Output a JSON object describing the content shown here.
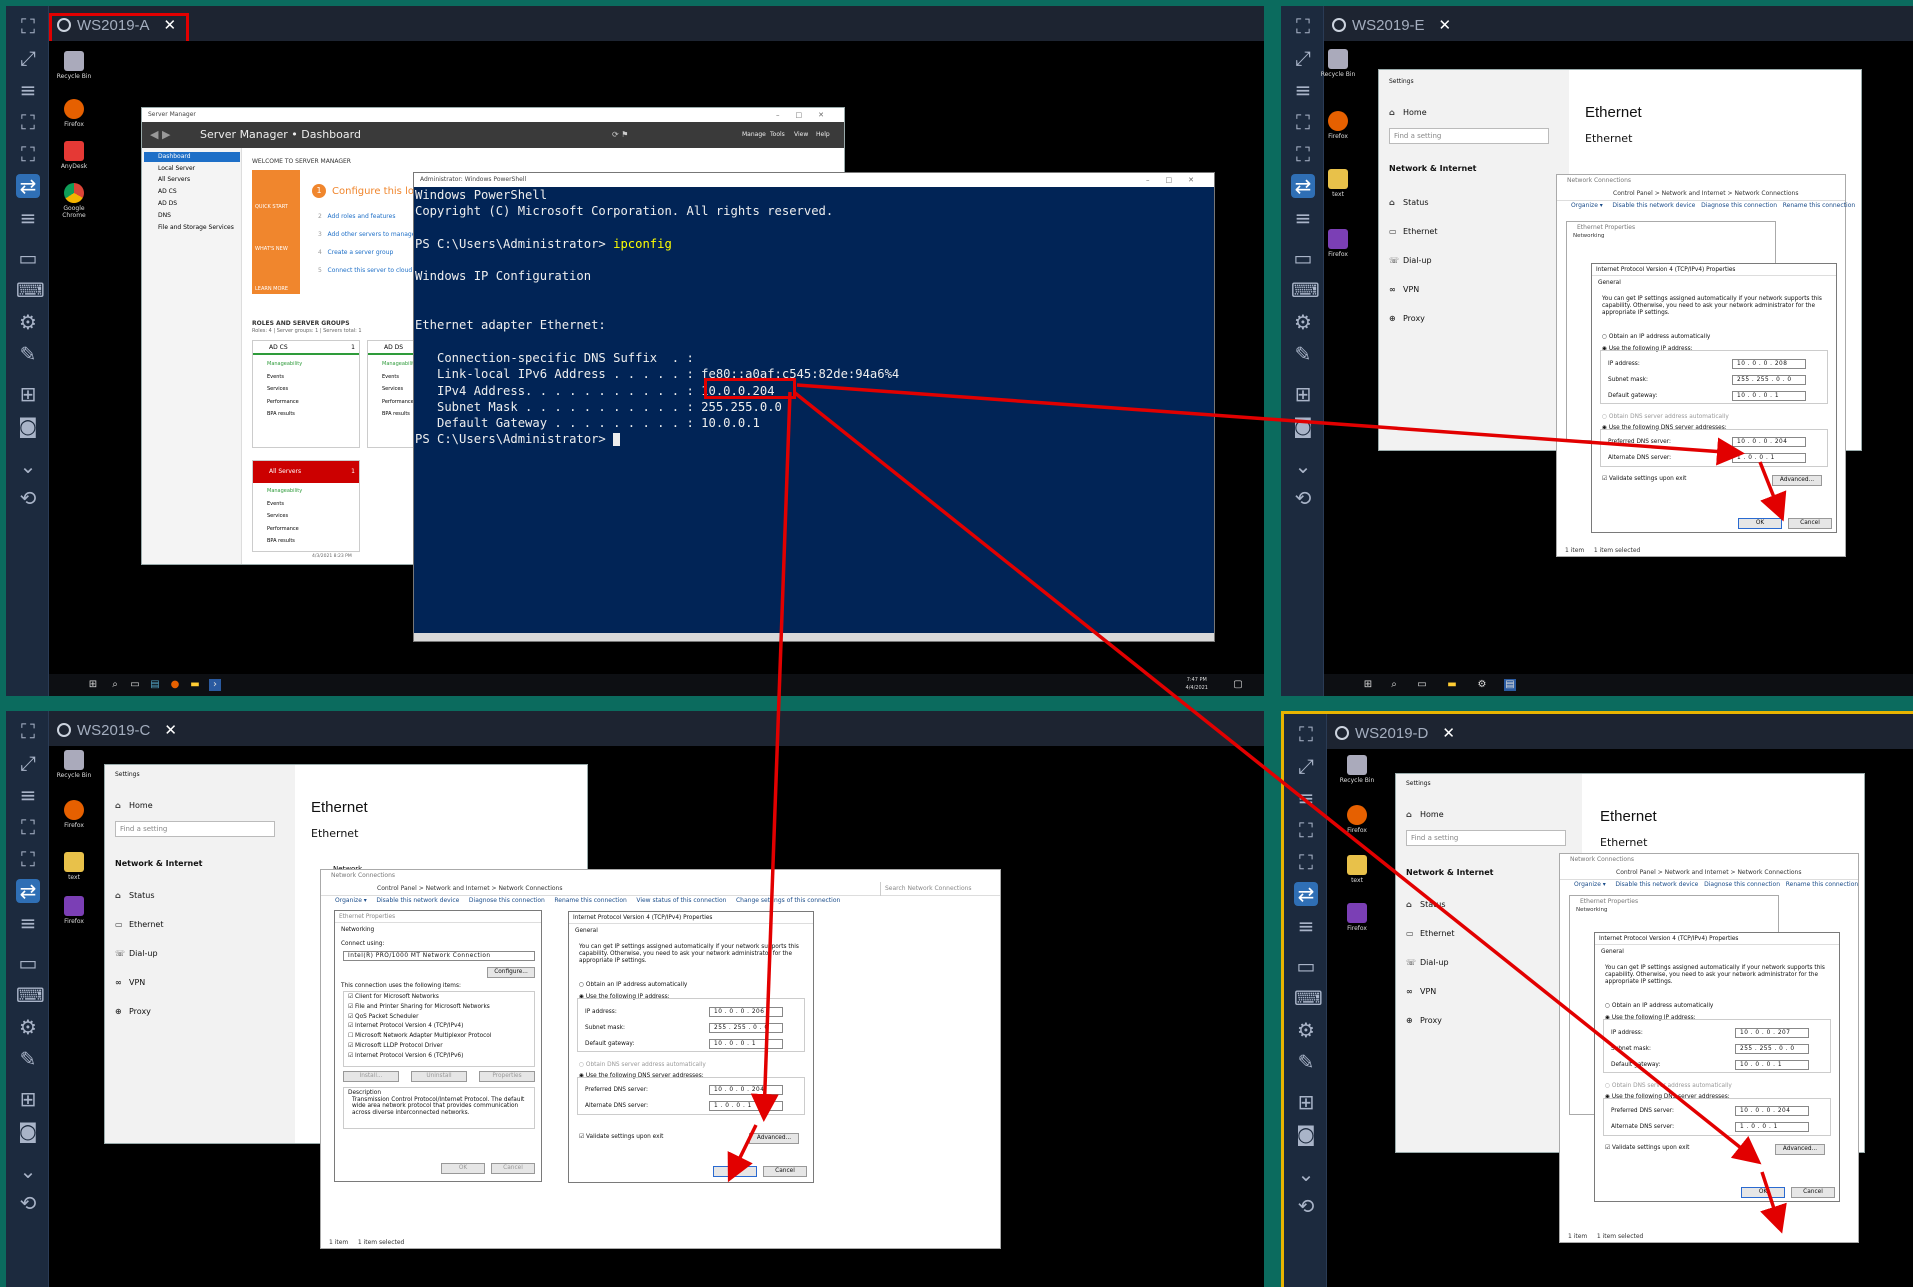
{
  "sessions": {
    "a": {
      "title": "WS2019-A"
    },
    "e": {
      "title": "WS2019-E"
    },
    "c": {
      "title": "WS2019-C"
    },
    "d": {
      "title": "WS2019-D"
    }
  },
  "desktop_icons": {
    "recycle": "Recycle Bin",
    "firefox": "Firefox",
    "anydesk": "AnyDesk",
    "chrome": "Google Chrome",
    "text": "text"
  },
  "server_manager": {
    "title": "Server Manager",
    "breadcrumb": "Server Manager • Dashboard",
    "menu": [
      "Manage",
      "Tools",
      "View",
      "Help"
    ],
    "nav": [
      "Dashboard",
      "Local Server",
      "All Servers",
      "AD CS",
      "AD DS",
      "DNS",
      "File and Storage Services"
    ],
    "welcome": "WELCOME TO SERVER MANAGER",
    "configure": "Configure this local server",
    "steps": [
      "Add roles and features",
      "Add other servers to manage",
      "Create a server group",
      "Connect this server to cloud services"
    ],
    "tiles": [
      "QUICK START",
      "WHAT'S NEW",
      "LEARN MORE"
    ],
    "roles_header": "ROLES AND SERVER GROUPS",
    "roles_sub": "Roles: 4  |  Server groups: 1  |  Servers total: 1",
    "cards": [
      {
        "name": "AD CS",
        "count": "1",
        "rows": [
          "Manageability",
          "Events",
          "Services",
          "Performance",
          "BPA results"
        ]
      },
      {
        "name": "AD DS",
        "count": "1",
        "rows": [
          "Manageability",
          "Events",
          "Services",
          "Performance",
          "BPA results"
        ]
      },
      {
        "name": "All Servers",
        "count": "1",
        "rows": [
          "Manageability",
          "Events",
          "Services",
          "Performance",
          "BPA results"
        ]
      }
    ],
    "timestamp": "4/3/2021 8:23 PM"
  },
  "powershell": {
    "title": "Administrator: Windows PowerShell",
    "lines": [
      "Windows PowerShell",
      "Copyright (C) Microsoft Corporation. All rights reserved.",
      "",
      "PS C:\\Users\\Administrator> ",
      "",
      "Windows IP Configuration",
      "",
      "",
      "Ethernet adapter Ethernet:",
      "",
      "   Connection-specific DNS Suffix  . :",
      "   Link-local IPv6 Address . . . . . : fe80::a0af:c545:82de:94a6%4",
      "   IPv4 Address. . . . . . . . . . . : 10.0.0.204",
      "   Subnet Mask . . . . . . . . . . . : 255.255.0.0",
      "   Default Gateway . . . . . . . . . : 10.0.0.1",
      "PS C:\\Users\\Administrator> "
    ],
    "command": "ipconfig"
  },
  "taskbar_a": {
    "time": "7:47 PM",
    "date": "4/4/2021"
  },
  "settings": {
    "title": "Settings",
    "home": "Home",
    "search_placeholder": "Find a setting",
    "section": "Network & Internet",
    "items": [
      "Status",
      "Ethernet",
      "Dial-up",
      "VPN",
      "Proxy"
    ],
    "heading": "Ethernet",
    "subheading": "Ethernet",
    "network": "Network"
  },
  "network_connections": {
    "title": "Network Connections",
    "path": "Control Panel  >  Network and Internet  >  Network Connections",
    "search": "Search Network Connections",
    "toolbar": [
      "Organize ▾",
      "Disable this network device",
      "Diagnose this connection",
      "Rename this connection",
      "View status of this connection",
      "Change settings of this connection"
    ],
    "status_items": "1 item",
    "status_selected": "1 item selected"
  },
  "ethernet_props": {
    "title": "Ethernet Properties",
    "tab": "Networking",
    "connect_using": "Connect using:",
    "adapter": "Intel(R) PRO/1000 MT Network Connection",
    "configure": "Configure...",
    "items_label": "This connection uses the following items:",
    "items": [
      "Client for Microsoft Networks",
      "File and Printer Sharing for Microsoft Networks",
      "QoS Packet Scheduler",
      "Internet Protocol Version 4 (TCP/IPv4)",
      "Microsoft Network Adapter Multiplexor Protocol",
      "Microsoft LLDP Protocol Driver",
      "Internet Protocol Version 6 (TCP/IPv6)"
    ],
    "install": "Install...",
    "uninstall": "Uninstall",
    "properties": "Properties",
    "description_label": "Description",
    "description": "Transmission Control Protocol/Internet Protocol. The default wide area network protocol that provides communication across diverse interconnected networks.",
    "ok": "OK",
    "cancel": "Cancel"
  },
  "ipv4": {
    "title": "Internet Protocol Version 4 (TCP/IPv4) Properties",
    "tab": "General",
    "intro": "You can get IP settings assigned automatically if your network supports this capability. Otherwise, you need to ask your network administrator for the appropriate IP settings.",
    "obtain_ip": "Obtain an IP address automatically",
    "use_ip": "Use the following IP address:",
    "ip_label": "IP address:",
    "mask_label": "Subnet mask:",
    "gw_label": "Default gateway:",
    "obtain_dns": "Obtain DNS server address automatically",
    "use_dns": "Use the following DNS server addresses:",
    "pref_label": "Preferred DNS server:",
    "alt_label": "Alternate DNS server:",
    "validate": "Validate settings upon exit",
    "advanced": "Advanced...",
    "ok": "OK",
    "cancel": "Cancel"
  },
  "ipv4_e": {
    "ip": "10 . 0 . 0 . 208",
    "mask": "255 . 255 . 0 . 0",
    "gw": "10 . 0 . 0 . 1",
    "pref": "10 . 0 . 0 . 204",
    "alt": "1 . 0 . 0 . 1"
  },
  "ipv4_c": {
    "ip": "10 . 0 . 0 . 206",
    "mask": "255 . 255 . 0 . 0",
    "gw": "10 . 0 . 0 . 1",
    "pref": "10 . 0 . 0 . 204",
    "alt": "1 . 0 . 0 . 1"
  },
  "ipv4_d": {
    "ip": "10 . 0 . 0 . 207",
    "mask": "255 . 255 . 0 . 0",
    "gw": "10 . 0 . 0 . 1",
    "pref": "10 . 0 . 0 . 204",
    "alt": "1 . 0 . 0 . 1"
  },
  "colors": {
    "annotation": "#e20000",
    "ps_bg": "#012456",
    "frame": "#0b6b5e",
    "sidebar": "#1c2a3e"
  }
}
